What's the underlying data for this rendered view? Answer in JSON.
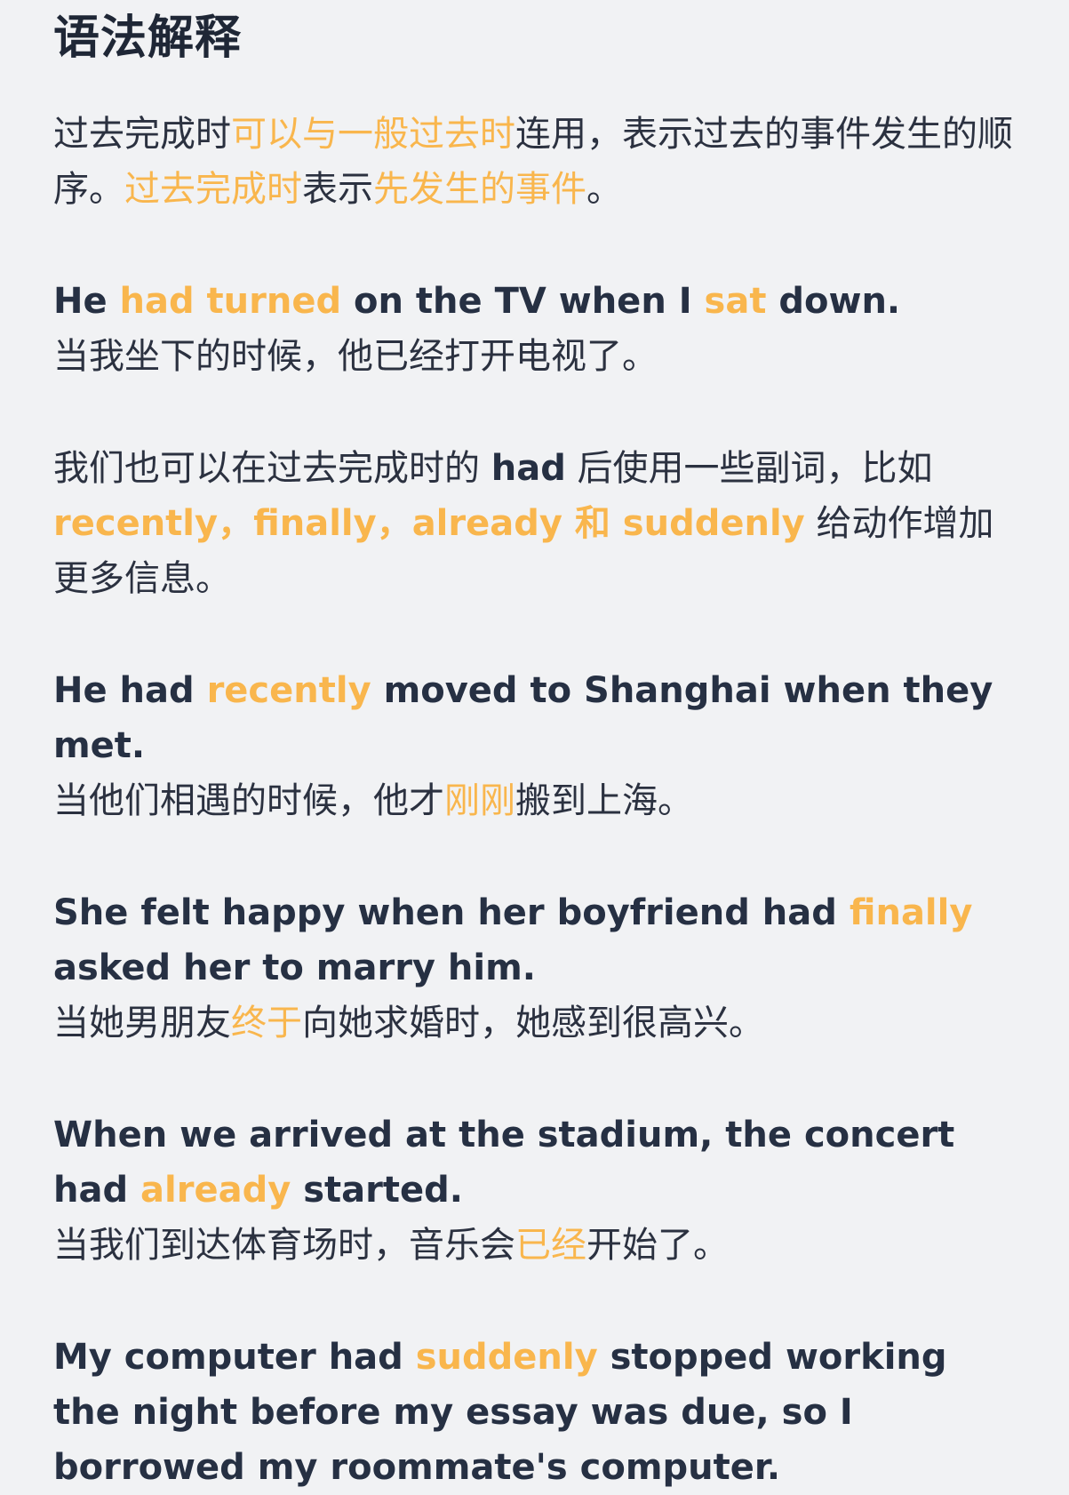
{
  "title": "语法解释",
  "colors": {
    "background": "#f1f2f4",
    "text": "#263043",
    "highlight": "#f9b64d"
  },
  "intro": {
    "p1": "过去完成时",
    "p2": "可以与一般过去时",
    "p3": "连用，表示过去的事件发生的顺序。",
    "p4": "过去完成时",
    "p5": "表示",
    "p6": "先发生的事件",
    "p7": "。"
  },
  "example1": {
    "en1": "He ",
    "en2": "had turned",
    "en3": " on the TV when I ",
    "en4": "sat",
    "en5": " down.",
    "zh": "当我坐下的时候，他已经打开电视了。"
  },
  "adverbs": {
    "p1": "我们也可以在过去完成时的 ",
    "p2": "had",
    "p3": " 后使用一些副词，比如 ",
    "p4": "recently，finally，already 和 suddenly",
    "p5": " 给动作增加更多信息。"
  },
  "example2": {
    "en1": "He had ",
    "en2": "recently",
    "en3": " moved to Shanghai when they met.",
    "zh1": "当他们相遇的时候，他才",
    "zh2": "刚刚",
    "zh3": "搬到上海。"
  },
  "example3": {
    "en1": "She felt happy when her boyfriend had ",
    "en2": "finally",
    "en3": " asked her to marry him.",
    "zh1": "当她男朋友",
    "zh2": "终于",
    "zh3": "向她求婚时，她感到很高兴。"
  },
  "example4": {
    "en1": "When we arrived at the stadium, the concert had ",
    "en2": "already",
    "en3": " started.",
    "zh1": "当我们到达体育场时，音乐会",
    "zh2": "已经",
    "zh3": "开始了。"
  },
  "example5": {
    "en1": "My computer had ",
    "en2": "suddenly",
    "en3": " stopped working the night before my essay was due, so I borrowed my roommate's computer."
  }
}
